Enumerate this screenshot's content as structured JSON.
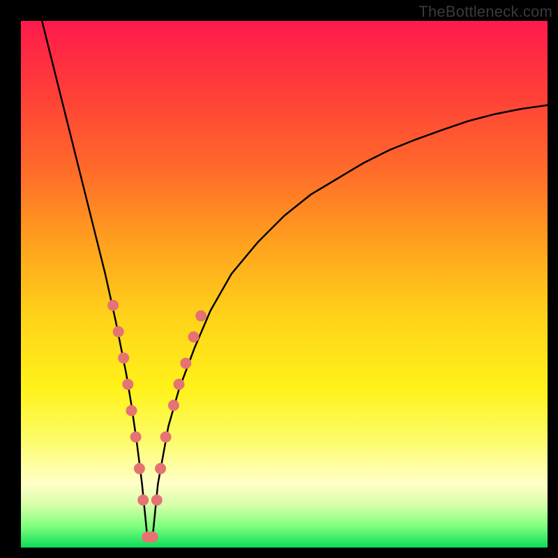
{
  "watermark": "TheBottleneck.com",
  "colors": {
    "curve": "#000000",
    "dots": "#e57373",
    "background_frame": "#000000"
  },
  "chart_data": {
    "type": "line",
    "title": "",
    "xlabel": "",
    "ylabel": "",
    "xlim": [
      0,
      100
    ],
    "ylim": [
      0,
      100
    ],
    "grid": false,
    "legend": false,
    "notes": "V-shaped bottleneck curve over a vertical red→green gradient. Minimum near x≈24, y≈0. Pink dots cluster on both arms near the bottom of the V.",
    "series": [
      {
        "name": "bottleneck-curve",
        "x": [
          4,
          6,
          8,
          10,
          12,
          14,
          16,
          18,
          20,
          21,
          22,
          23,
          24,
          25,
          26,
          28,
          30,
          33,
          36,
          40,
          45,
          50,
          55,
          60,
          65,
          70,
          75,
          80,
          85,
          90,
          95,
          100
        ],
        "y": [
          100,
          92,
          84,
          76,
          68,
          60,
          52,
          43,
          33,
          27,
          20,
          12,
          2,
          2,
          12,
          23,
          30,
          38,
          45,
          52,
          58,
          63,
          67,
          70,
          73,
          75.5,
          77.5,
          79.3,
          81,
          82.3,
          83.3,
          84
        ]
      }
    ],
    "dots": {
      "name": "sample-points",
      "x": [
        17.5,
        18.5,
        19.5,
        20.3,
        21.0,
        21.8,
        22.5,
        23.2,
        24.0,
        25.0,
        25.8,
        26.5,
        27.5,
        29.0,
        30.0,
        31.3,
        32.8,
        34.2
      ],
      "y": [
        46,
        41,
        36,
        31,
        26,
        21,
        15,
        9,
        2,
        2,
        9,
        15,
        21,
        27,
        31,
        35,
        40,
        44
      ]
    }
  }
}
